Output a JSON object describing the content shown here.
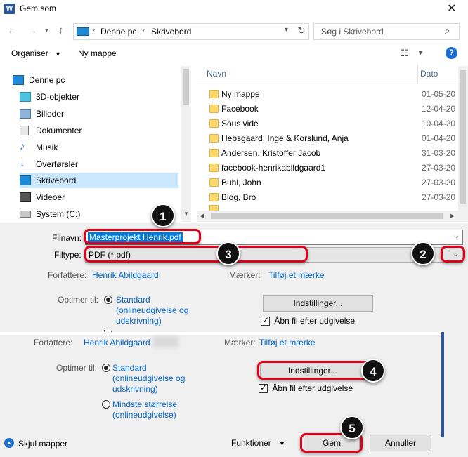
{
  "window": {
    "title": "Gem som",
    "app_icon": "W"
  },
  "nav": {
    "path": [
      "Denne pc",
      "Skrivebord"
    ],
    "search_placeholder": "Søg i Skrivebord"
  },
  "toolbar": {
    "organize": "Organiser",
    "new_folder": "Ny mappe"
  },
  "sidebar": {
    "items": [
      {
        "label": "Denne pc",
        "icon": "pc-icon"
      },
      {
        "label": "3D-objekter",
        "icon": "cube-icon"
      },
      {
        "label": "Billeder",
        "icon": "pictures-icon"
      },
      {
        "label": "Dokumenter",
        "icon": "documents-icon"
      },
      {
        "label": "Musik",
        "icon": "music-icon"
      },
      {
        "label": "Overførsler",
        "icon": "download-icon"
      },
      {
        "label": "Skrivebord",
        "icon": "desktop-icon"
      },
      {
        "label": "Videoer",
        "icon": "videos-icon"
      },
      {
        "label": "System (C:)",
        "icon": "drive-icon"
      }
    ]
  },
  "files": {
    "col_name": "Navn",
    "col_date": "Dato",
    "rows": [
      {
        "name": "Ny mappe",
        "date": "01-05-20"
      },
      {
        "name": "Facebook",
        "date": "12-04-20"
      },
      {
        "name": "Sous vide",
        "date": "10-04-20"
      },
      {
        "name": "Hebsgaard, Inge & Korslund, Anja",
        "date": "01-04-20"
      },
      {
        "name": "Andersen, Kristoffer Jacob",
        "date": "31-03-20"
      },
      {
        "name": "facebook-henrikabildgaard1",
        "date": "27-03-20"
      },
      {
        "name": "Buhl, John",
        "date": "27-03-20"
      },
      {
        "name": "Blog, Bro",
        "date": "27-03-20"
      }
    ]
  },
  "form": {
    "filename_label": "Filnavn:",
    "filename_value": "Masterprojekt Henrik.pdf",
    "filetype_label": "Filtype:",
    "filetype_value": "PDF (*.pdf)",
    "authors_label": "Forfattere:",
    "authors_value": "Henrik Abildgaard",
    "tags_label": "Mærker:",
    "tags_value": "Tilføj et mærke",
    "optimize_label": "Optimer til:",
    "opt_standard": [
      "Standard",
      "(onlineudgivelse og",
      "udskrivning)"
    ],
    "opt_minimum": [
      "Mindste størrelse",
      "(onlineudgivelse)"
    ],
    "settings_button": "Indstillinger...",
    "open_after": "Åbn fil efter udgivelse"
  },
  "footer": {
    "hide_folders": "Skjul mapper",
    "functions": "Funktioner",
    "save": "Gem",
    "cancel": "Annuller"
  },
  "annotations": [
    "1",
    "2",
    "3",
    "4",
    "5"
  ],
  "colors": {
    "highlight": "#e0001a",
    "link": "#0066cc",
    "selection": "#cce8ff"
  }
}
